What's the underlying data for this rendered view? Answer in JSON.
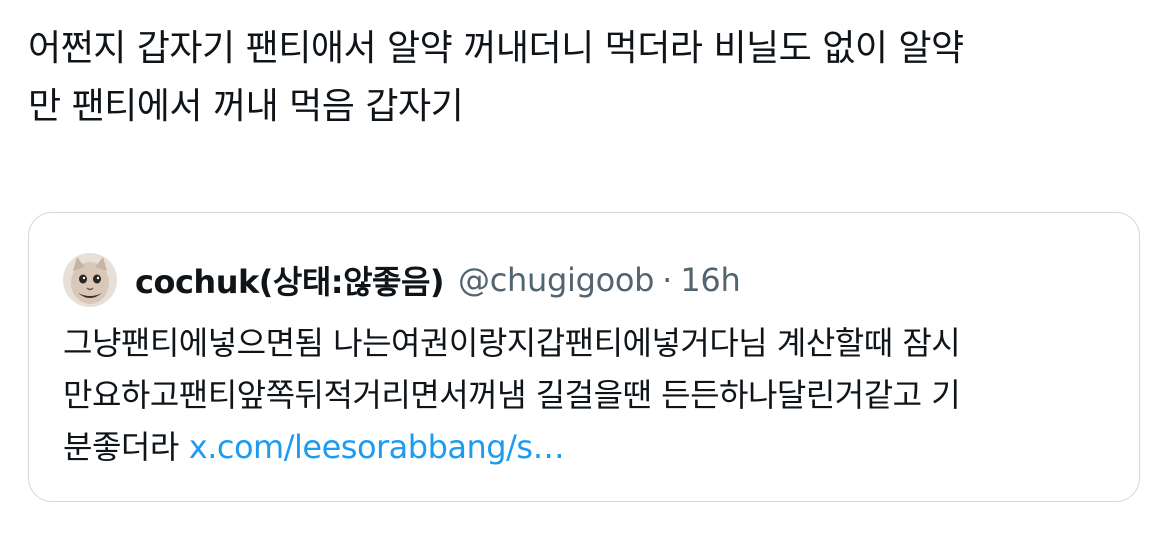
{
  "tweet": {
    "text_line_1": "어쩐지 갑자기 팬티애서 알약 꺼내더니 먹더라 비닐도 없이 알약",
    "text_line_2": "만 팬티에서 꺼내 먹음 갑자기"
  },
  "quoted_tweet": {
    "avatar_icon": "cat-face-avatar-icon",
    "display_name": "cochuk(상태:않좋음)",
    "handle": "@chugigoob",
    "separator": "·",
    "timestamp": "16h",
    "body_line_1": "그냥팬티에넣으면됨 나는여권이랑지갑팬티에넣거다님 계산할때 잠시",
    "body_line_2": "만요하고팬티앞쪽뒤적거리면서꺼냄  길걸을땐 든든하나달린거같고 기",
    "body_line_3": "분좋더라",
    "link_text": "x.com/leesorabbang/s…"
  },
  "colors": {
    "text_primary": "#0f1419",
    "text_secondary": "#536471",
    "link": "#1d9bf0",
    "border": "#cfd9de"
  }
}
